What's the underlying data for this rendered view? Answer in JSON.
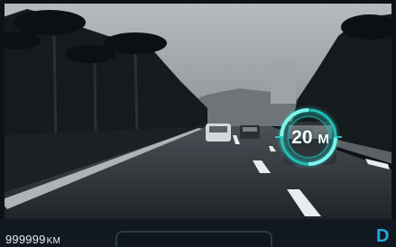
{
  "hud": {
    "odometer_value": "999999",
    "odometer_unit": "KM",
    "gear": "D",
    "target_distance": "20",
    "target_distance_unit": "M"
  },
  "colors": {
    "accent_cyan": "#25c7c0",
    "gear_blue": "#1ea9e0"
  },
  "icons": {
    "target_ring": "target-ring-icon"
  }
}
